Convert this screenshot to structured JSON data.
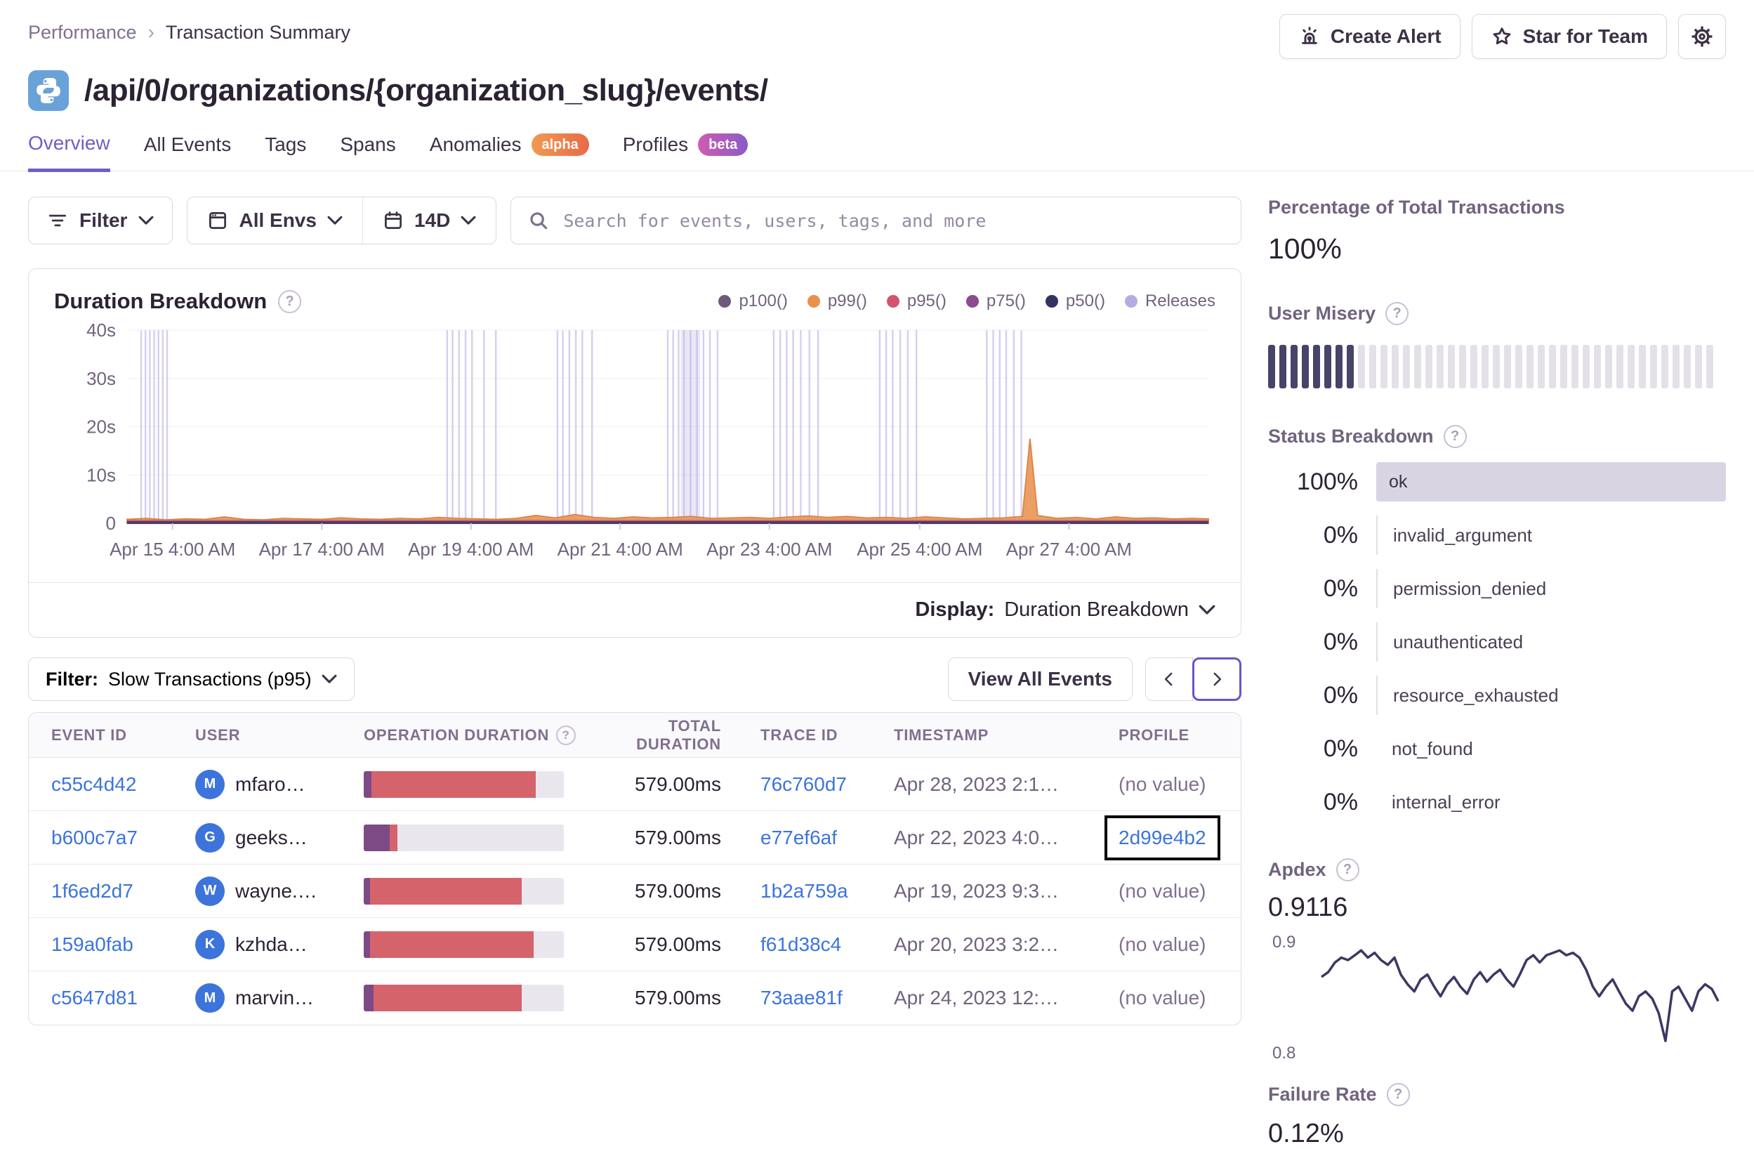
{
  "breadcrumb": {
    "parent": "Performance",
    "current": "Transaction Summary"
  },
  "actions": {
    "create_alert": "Create Alert",
    "star_for_team": "Star for Team"
  },
  "header": {
    "title": "/api/0/organizations/{organization_slug}/events/"
  },
  "tabs": [
    {
      "label": "Overview",
      "active": true
    },
    {
      "label": "All Events"
    },
    {
      "label": "Tags"
    },
    {
      "label": "Spans"
    },
    {
      "label": "Anomalies",
      "badge": "alpha"
    },
    {
      "label": "Profiles",
      "badge": "beta"
    }
  ],
  "toolbar": {
    "filter_label": "Filter",
    "envs_label": "All Envs",
    "period_label": "14D",
    "search_placeholder": "Search for events, users, tags, and more"
  },
  "chart_panel": {
    "title": "Duration Breakdown",
    "display_label": "Display:",
    "display_value": "Duration Breakdown",
    "legend": [
      {
        "label": "p100()",
        "color": "#6e5a7d"
      },
      {
        "label": "p99()",
        "color": "#e8924d"
      },
      {
        "label": "p95()",
        "color": "#d4536f"
      },
      {
        "label": "p75()",
        "color": "#8c4a8f"
      },
      {
        "label": "p50()",
        "color": "#35335f"
      },
      {
        "label": "Releases",
        "color": "#b5abe2"
      }
    ]
  },
  "chart_data": [
    {
      "id": "duration_breakdown",
      "type": "area",
      "title": "Duration Breakdown",
      "ylim_seconds": [
        0,
        40
      ],
      "y_ticks": [
        "40s",
        "30s",
        "20s",
        "10s",
        "0"
      ],
      "x_ticks": [
        "Apr 15 4:00 AM",
        "Apr 17 4:00 AM",
        "Apr 19 4:00 AM",
        "Apr 21 4:00 AM",
        "Apr 23 4:00 AM",
        "Apr 25 4:00 AM",
        "Apr 27 4:00 AM"
      ],
      "x_tick_fractions": [
        0.042,
        0.18,
        0.318,
        0.456,
        0.594,
        0.733,
        0.871
      ],
      "grid": true,
      "legend_position": "top-right",
      "series": [
        {
          "name": "p99()",
          "color": "#e8924d",
          "render": "area",
          "points": [
            [
              0,
              0.8
            ],
            [
              0.018,
              1.0
            ],
            [
              0.036,
              0.7
            ],
            [
              0.054,
              0.9
            ],
            [
              0.072,
              0.8
            ],
            [
              0.09,
              1.3
            ],
            [
              0.108,
              0.8
            ],
            [
              0.126,
              0.7
            ],
            [
              0.144,
              1.0
            ],
            [
              0.162,
              0.9
            ],
            [
              0.18,
              0.8
            ],
            [
              0.198,
              1.1
            ],
            [
              0.216,
              0.9
            ],
            [
              0.234,
              0.8
            ],
            [
              0.252,
              1.0
            ],
            [
              0.27,
              0.9
            ],
            [
              0.288,
              1.2
            ],
            [
              0.306,
              1.0
            ],
            [
              0.324,
              0.9
            ],
            [
              0.342,
              0.8
            ],
            [
              0.36,
              1.0
            ],
            [
              0.378,
              1.6
            ],
            [
              0.396,
              1.1
            ],
            [
              0.414,
              1.8
            ],
            [
              0.432,
              1.2
            ],
            [
              0.45,
              1.0
            ],
            [
              0.468,
              1.3
            ],
            [
              0.486,
              1.1
            ],
            [
              0.504,
              1.2
            ],
            [
              0.522,
              1.4
            ],
            [
              0.54,
              1.0
            ],
            [
              0.558,
              1.1
            ],
            [
              0.576,
              1.2
            ],
            [
              0.594,
              1.0
            ],
            [
              0.612,
              1.3
            ],
            [
              0.63,
              1.5
            ],
            [
              0.648,
              1.2
            ],
            [
              0.666,
              1.4
            ],
            [
              0.684,
              1.1
            ],
            [
              0.702,
              1.2
            ],
            [
              0.72,
              1.0
            ],
            [
              0.738,
              1.3
            ],
            [
              0.756,
              1.1
            ],
            [
              0.774,
              0.9
            ],
            [
              0.792,
              1.0
            ],
            [
              0.81,
              1.1
            ],
            [
              0.828,
              1.4
            ],
            [
              0.835,
              17.5
            ],
            [
              0.842,
              1.6
            ],
            [
              0.86,
              1.0
            ],
            [
              0.878,
              1.2
            ],
            [
              0.896,
              0.9
            ],
            [
              0.914,
              1.3
            ],
            [
              0.932,
              1.0
            ],
            [
              0.95,
              1.1
            ],
            [
              0.968,
              0.9
            ],
            [
              0.986,
              1.0
            ],
            [
              1,
              0.9
            ]
          ]
        },
        {
          "name": "p95()",
          "color": "#c65b72",
          "render": "flat-line",
          "flat_seconds": 0.45
        },
        {
          "name": "p50()/p75()/p100()",
          "color": "#4a3c63",
          "render": "flat-line",
          "flat_seconds": 0.12
        }
      ],
      "releases": {
        "color": "#b9b0e4",
        "band": [
          0.512,
          0.53
        ],
        "positions": [
          0.013,
          0.017,
          0.021,
          0.025,
          0.029,
          0.033,
          0.037,
          0.296,
          0.301,
          0.307,
          0.313,
          0.319,
          0.33,
          0.341,
          0.398,
          0.403,
          0.409,
          0.415,
          0.421,
          0.43,
          0.5,
          0.505,
          0.51,
          0.515,
          0.521,
          0.527,
          0.533,
          0.539,
          0.546,
          0.598,
          0.604,
          0.61,
          0.616,
          0.623,
          0.631,
          0.639,
          0.696,
          0.702,
          0.708,
          0.715,
          0.722,
          0.73,
          0.795,
          0.801,
          0.807,
          0.813,
          0.82,
          0.827
        ]
      }
    },
    {
      "id": "apdex_trend",
      "type": "line",
      "color": "#3b3862",
      "ylim": [
        0.8,
        0.9
      ],
      "y_labels": [
        "0.9",
        "0.8"
      ],
      "points": [
        [
          0,
          0.868
        ],
        [
          0.017,
          0.872
        ],
        [
          0.034,
          0.88
        ],
        [
          0.05,
          0.884
        ],
        [
          0.067,
          0.882
        ],
        [
          0.084,
          0.886
        ],
        [
          0.1,
          0.89
        ],
        [
          0.117,
          0.884
        ],
        [
          0.134,
          0.888
        ],
        [
          0.15,
          0.882
        ],
        [
          0.167,
          0.878
        ],
        [
          0.184,
          0.884
        ],
        [
          0.2,
          0.87
        ],
        [
          0.217,
          0.862
        ],
        [
          0.234,
          0.856
        ],
        [
          0.25,
          0.866
        ],
        [
          0.267,
          0.87
        ],
        [
          0.284,
          0.86
        ],
        [
          0.3,
          0.852
        ],
        [
          0.317,
          0.862
        ],
        [
          0.334,
          0.868
        ],
        [
          0.35,
          0.86
        ],
        [
          0.367,
          0.854
        ],
        [
          0.384,
          0.866
        ],
        [
          0.4,
          0.872
        ],
        [
          0.417,
          0.864
        ],
        [
          0.434,
          0.87
        ],
        [
          0.45,
          0.874
        ],
        [
          0.467,
          0.866
        ],
        [
          0.484,
          0.86
        ],
        [
          0.5,
          0.87
        ],
        [
          0.517,
          0.882
        ],
        [
          0.534,
          0.886
        ],
        [
          0.55,
          0.88
        ],
        [
          0.567,
          0.886
        ],
        [
          0.584,
          0.888
        ],
        [
          0.6,
          0.89
        ],
        [
          0.617,
          0.886
        ],
        [
          0.634,
          0.888
        ],
        [
          0.65,
          0.884
        ],
        [
          0.667,
          0.874
        ],
        [
          0.684,
          0.86
        ],
        [
          0.7,
          0.852
        ],
        [
          0.717,
          0.86
        ],
        [
          0.734,
          0.866
        ],
        [
          0.75,
          0.856
        ],
        [
          0.767,
          0.846
        ],
        [
          0.784,
          0.84
        ],
        [
          0.8,
          0.852
        ],
        [
          0.817,
          0.856
        ],
        [
          0.834,
          0.85
        ],
        [
          0.85,
          0.838
        ],
        [
          0.867,
          0.815
        ],
        [
          0.884,
          0.856
        ],
        [
          0.9,
          0.86
        ],
        [
          0.917,
          0.85
        ],
        [
          0.934,
          0.84
        ],
        [
          0.95,
          0.856
        ],
        [
          0.967,
          0.862
        ],
        [
          0.984,
          0.858
        ],
        [
          1,
          0.848
        ]
      ]
    }
  ],
  "events_toolbar": {
    "filter_label": "Filter:",
    "filter_value": "Slow Transactions (p95)",
    "view_all": "View All Events"
  },
  "table": {
    "headers": [
      "EVENT ID",
      "USER",
      "OPERATION DURATION",
      "TOTAL DURATION",
      "TRACE ID",
      "TIMESTAMP",
      "PROFILE"
    ],
    "bar_colors": {
      "purple": "#7d4a86",
      "red": "#d4636c",
      "rest": "#eae6ee"
    },
    "rows": [
      {
        "event_id": "c55c4d42",
        "user_initial": "M",
        "user_name": "mfaro…",
        "bar": {
          "purple": 4,
          "red": 82
        },
        "total": "579.00ms",
        "trace_id": "76c760d7",
        "timestamp": "Apr 28, 2023 2:1…",
        "profile": "(no value)",
        "profile_link": false,
        "profile_focus": false
      },
      {
        "event_id": "b600c7a7",
        "user_initial": "G",
        "user_name": "geeks…",
        "bar": {
          "purple": 13,
          "red": 4
        },
        "total": "579.00ms",
        "trace_id": "e77ef6af",
        "timestamp": "Apr 22, 2023 4:0…",
        "profile": "2d99e4b2",
        "profile_link": true,
        "profile_focus": true
      },
      {
        "event_id": "1f6ed2d7",
        "user_initial": "W",
        "user_name": "wayne.…",
        "bar": {
          "purple": 3,
          "red": 76
        },
        "total": "579.00ms",
        "trace_id": "1b2a759a",
        "timestamp": "Apr 19, 2023 9:3…",
        "profile": "(no value)",
        "profile_link": false,
        "profile_focus": false
      },
      {
        "event_id": "159a0fab",
        "user_initial": "K",
        "user_name": "kzhda…",
        "bar": {
          "purple": 3,
          "red": 82
        },
        "total": "579.00ms",
        "trace_id": "f61d38c4",
        "timestamp": "Apr 20, 2023 3:2…",
        "profile": "(no value)",
        "profile_link": false,
        "profile_focus": false
      },
      {
        "event_id": "c5647d81",
        "user_initial": "M",
        "user_name": "marvin…",
        "bar": {
          "purple": 5,
          "red": 74
        },
        "total": "579.00ms",
        "trace_id": "73aae81f",
        "timestamp": "Apr 24, 2023 12:…",
        "profile": "(no value)",
        "profile_link": false,
        "profile_focus": false
      }
    ]
  },
  "sidebar": {
    "pct_title": "Percentage of Total Transactions",
    "pct_value": "100%",
    "misery_title": "User Misery",
    "misery": {
      "total_bars": 40,
      "filled_bars": 8,
      "filled_color": "#474469",
      "empty_color": "#e4e0e8"
    },
    "status_title": "Status Breakdown",
    "status_rows": [
      {
        "value": "100%",
        "label": "ok",
        "bar": true,
        "tick": false
      },
      {
        "value": "0%",
        "label": "invalid_argument",
        "bar": false,
        "tick": true
      },
      {
        "value": "0%",
        "label": "permission_denied",
        "bar": false,
        "tick": true
      },
      {
        "value": "0%",
        "label": "unauthenticated",
        "bar": false,
        "tick": true
      },
      {
        "value": "0%",
        "label": "resource_exhausted",
        "bar": false,
        "tick": true
      },
      {
        "value": "0%",
        "label": "not_found",
        "bar": false,
        "tick": false
      },
      {
        "value": "0%",
        "label": "internal_error",
        "bar": false,
        "tick": false
      }
    ],
    "apdex_title": "Apdex",
    "apdex_value": "0.9116",
    "apdex_hi": "0.9",
    "apdex_lo": "0.8",
    "failure_title": "Failure Rate",
    "failure_value": "0.12%"
  }
}
